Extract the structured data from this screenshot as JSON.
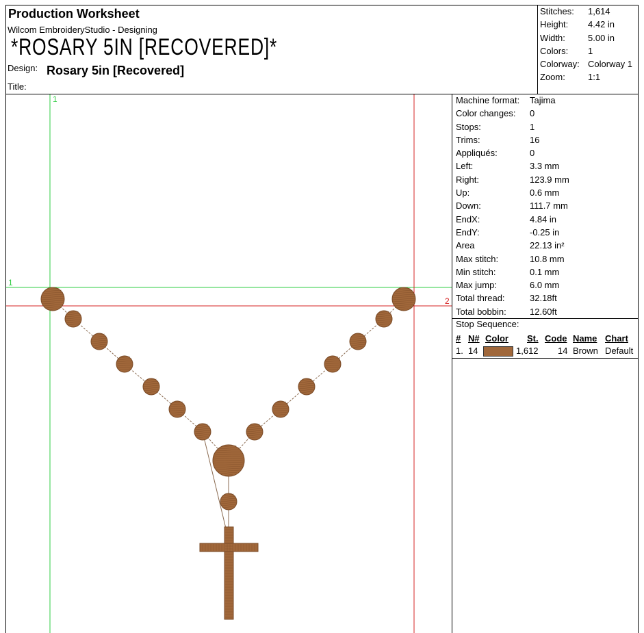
{
  "header": {
    "title": "Production Worksheet",
    "app_line": "Wilcom EmbroideryStudio - Designing",
    "design_big": "*ROSARY 5IN [RECOVERED]*",
    "design_label": "Design:",
    "design_name": "Rosary 5in [Recovered]",
    "title_label": "Title:"
  },
  "summary": [
    {
      "label": "Stitches:",
      "value": "1,614"
    },
    {
      "label": "Height:",
      "value": "4.42 in"
    },
    {
      "label": "Width:",
      "value": "5.00 in"
    },
    {
      "label": "Colors:",
      "value": "1"
    },
    {
      "label": "Colorway:",
      "value": "Colorway 1"
    },
    {
      "label": "Zoom:",
      "value": "1:1"
    }
  ],
  "stats": [
    {
      "label": "Machine format:",
      "value": "Tajima"
    },
    {
      "label": "Color changes:",
      "value": "0"
    },
    {
      "label": "Stops:",
      "value": "1"
    },
    {
      "label": "Trims:",
      "value": "16"
    },
    {
      "label": "Appliqués:",
      "value": "0"
    },
    {
      "label": "Left:",
      "value": "3.3 mm"
    },
    {
      "label": "Right:",
      "value": "123.9 mm"
    },
    {
      "label": "Up:",
      "value": "0.6 mm"
    },
    {
      "label": "Down:",
      "value": "111.7 mm"
    },
    {
      "label": "EndX:",
      "value": "4.84 in"
    },
    {
      "label": "EndY:",
      "value": "-0.25 in"
    },
    {
      "label": "Area",
      "value": " 22.13 in²"
    },
    {
      "label": "Max stitch:",
      "value": "10.8 mm"
    },
    {
      "label": "Min stitch:",
      "value": "0.1 mm"
    },
    {
      "label": "Max jump:",
      "value": "6.0 mm"
    },
    {
      "label": "Total thread:",
      "value": "32.18ft"
    },
    {
      "label": "Total bobbin:",
      "value": "12.60ft"
    }
  ],
  "stop_sequence": {
    "title": "Stop Sequence:",
    "headers": {
      "num": "#",
      "n": "N#",
      "color": "Color",
      "st": "St.",
      "code": "Code",
      "name": "Name",
      "chart": "Chart"
    },
    "rows": [
      {
        "num": "1.",
        "n": "14",
        "color": "#A0673A",
        "st": "1,612",
        "code": "14",
        "name": "Brown",
        "chart": "Default"
      }
    ]
  },
  "guides": {
    "green_v_label": "1",
    "green_h_label": "1",
    "red_h_label": "2"
  },
  "colors": {
    "thread": "#A0673A",
    "thread_dark": "#7a4a26",
    "guide_green": "#2ecc40",
    "guide_red": "#d62020"
  }
}
